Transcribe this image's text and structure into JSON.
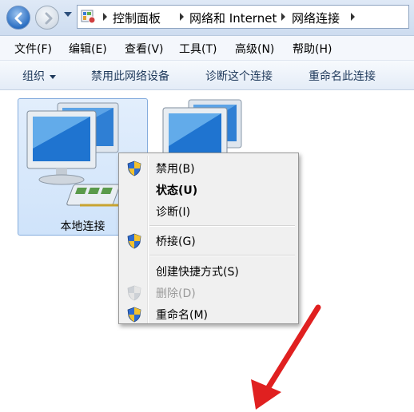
{
  "address_bar": {
    "breadcrumbs": [
      "控制面板",
      "网络和 Internet",
      "网络连接"
    ],
    "icon": "control-panel-icon"
  },
  "menu": {
    "items": [
      "文件(F)",
      "编辑(E)",
      "查看(V)",
      "工具(T)",
      "高级(N)",
      "帮助(H)"
    ]
  },
  "toolbar": {
    "organize": "组织",
    "disable": "禁用此网络设备",
    "diagnose": "诊断这个连接",
    "rename": "重命名此连接"
  },
  "connections": [
    {
      "label": "本地连接",
      "selected": true,
      "icon": "network-adapter-icon"
    },
    {
      "label": "",
      "selected": false,
      "icon": "network-adapter-icon"
    }
  ],
  "context_menu": {
    "items": [
      {
        "label": "禁用(B)",
        "shield": true,
        "bold": false,
        "disabled": false
      },
      {
        "label": "状态(U)",
        "shield": false,
        "bold": true,
        "disabled": false
      },
      {
        "label": "诊断(I)",
        "shield": false,
        "bold": false,
        "disabled": false
      },
      {
        "label": "桥接(G)",
        "shield": true,
        "bold": false,
        "disabled": false
      },
      {
        "label": "创建快捷方式(S)",
        "shield": false,
        "bold": false,
        "disabled": false
      },
      {
        "label": "删除(D)",
        "shield": true,
        "bold": false,
        "disabled": true
      },
      {
        "label": "重命名(M)",
        "shield": true,
        "bold": false,
        "disabled": false
      }
    ]
  },
  "colors": {
    "annotation_arrow": "#e02020",
    "selection": "#cfe3fa",
    "shield_blue": "#2d6bd1",
    "shield_yellow": "#f2c12e"
  }
}
